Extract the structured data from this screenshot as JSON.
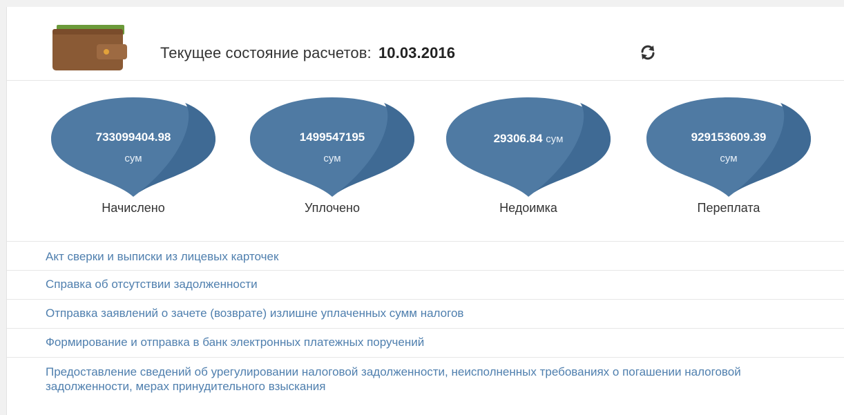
{
  "header": {
    "title": "Текущее состояние расчетов:",
    "date": "10.03.2016",
    "wallet_icon": "wallet-icon",
    "refresh_icon": "refresh-icon"
  },
  "colors": {
    "drop_fill": "#4f7aa3",
    "drop_shade": "#3f6a94",
    "link": "#4f7fae",
    "text": "#333333"
  },
  "stats": [
    {
      "value": "733099404.98",
      "unit": "сум",
      "label": "Начислено"
    },
    {
      "value": "1499547195",
      "unit": "сум",
      "label": "Уплочено"
    },
    {
      "value": "29306.84",
      "unit": "сум",
      "label": "Недоимка"
    },
    {
      "value": "929153609.39",
      "unit": "сум",
      "label": "Переплата"
    }
  ],
  "links": [
    "Акт сверки и выписки из лицевых карточек",
    "Справка об отсутствии задолженности",
    "Отправка заявлений о зачете (возврате) излишне уплаченных сумм налогов",
    "Формирование и отправка в банк электронных платежных поручений",
    "Предоставление сведений об урегулировании налоговой задолженности, неисполненных требованиях о погашении налоговой задолженности, мерах принудительного взыскания"
  ]
}
